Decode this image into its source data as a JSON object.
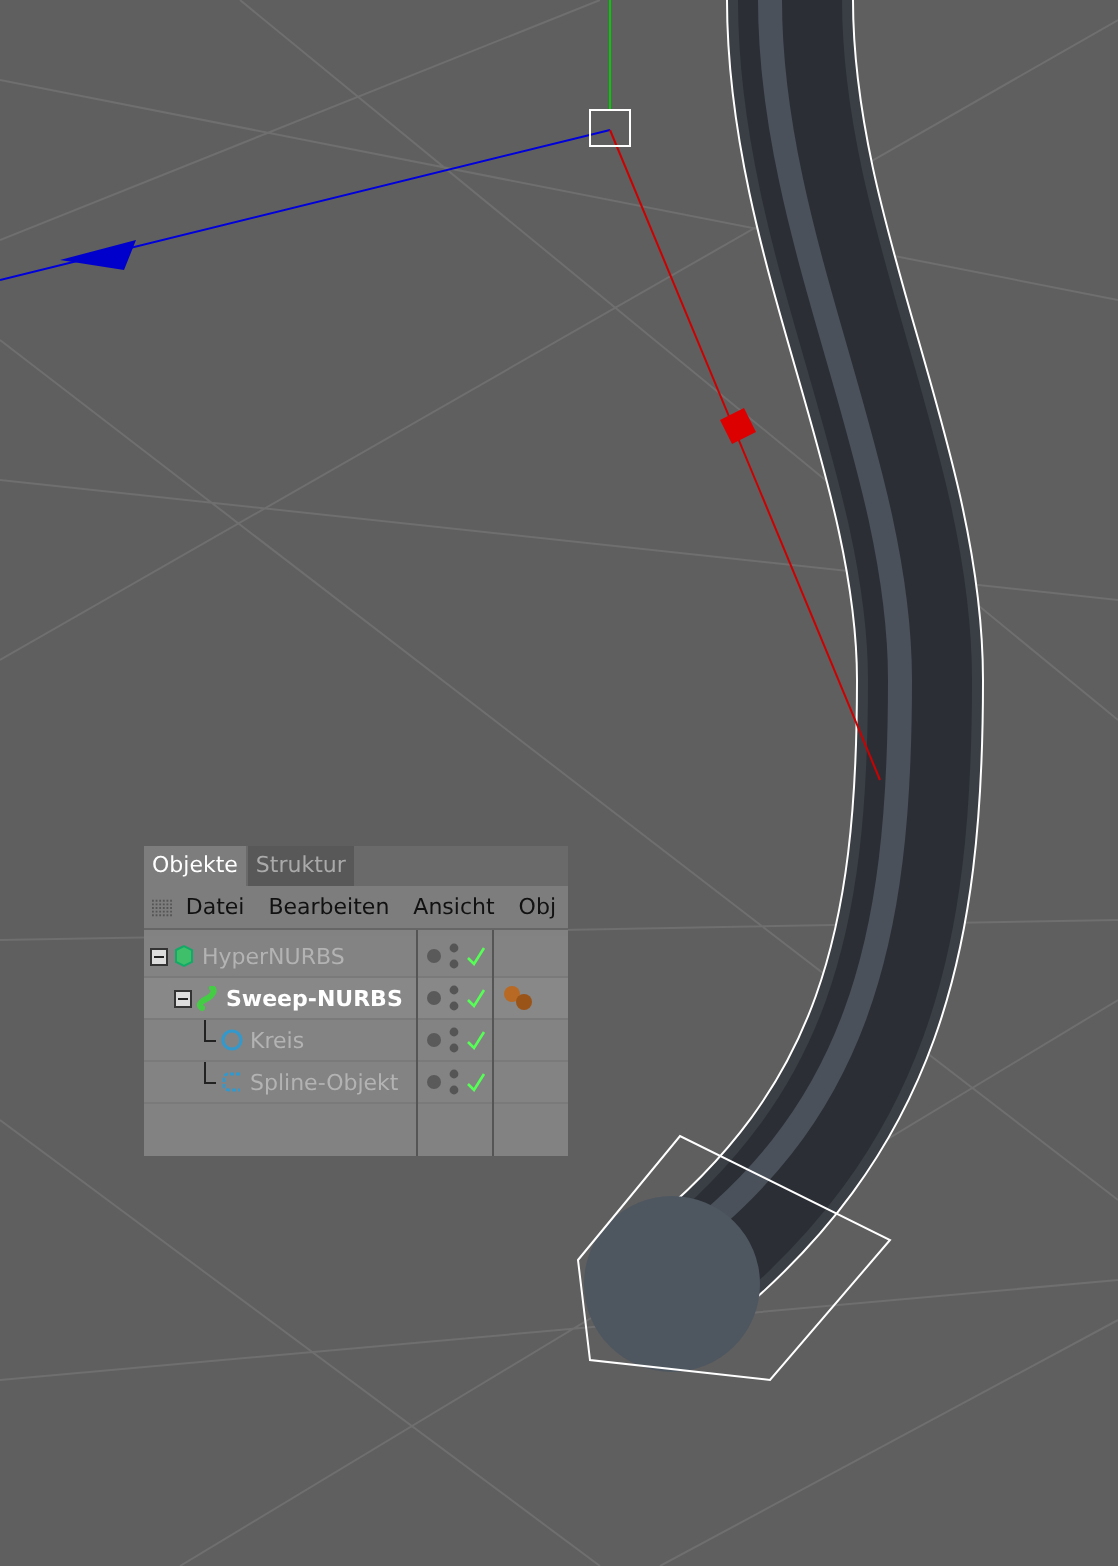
{
  "panel": {
    "tabs": [
      {
        "label": "Objekte",
        "selected": true
      },
      {
        "label": "Struktur",
        "selected": false
      }
    ],
    "menu": [
      "Datei",
      "Bearbeiten",
      "Ansicht",
      "Obj"
    ],
    "objects": [
      {
        "name": "HyperNURBS",
        "kind": "hypernurbs",
        "selected": false,
        "expanded": true,
        "enabled": true,
        "tag": false,
        "children": [
          {
            "name": "Sweep-NURBS",
            "kind": "sweep",
            "selected": true,
            "expanded": true,
            "enabled": true,
            "tag": true,
            "children": [
              {
                "name": "Kreis",
                "kind": "circle",
                "selected": false,
                "enabled": true,
                "tag": false
              },
              {
                "name": "Spline-Objekt",
                "kind": "spline",
                "selected": false,
                "enabled": true,
                "tag": false
              }
            ]
          }
        ]
      }
    ]
  }
}
